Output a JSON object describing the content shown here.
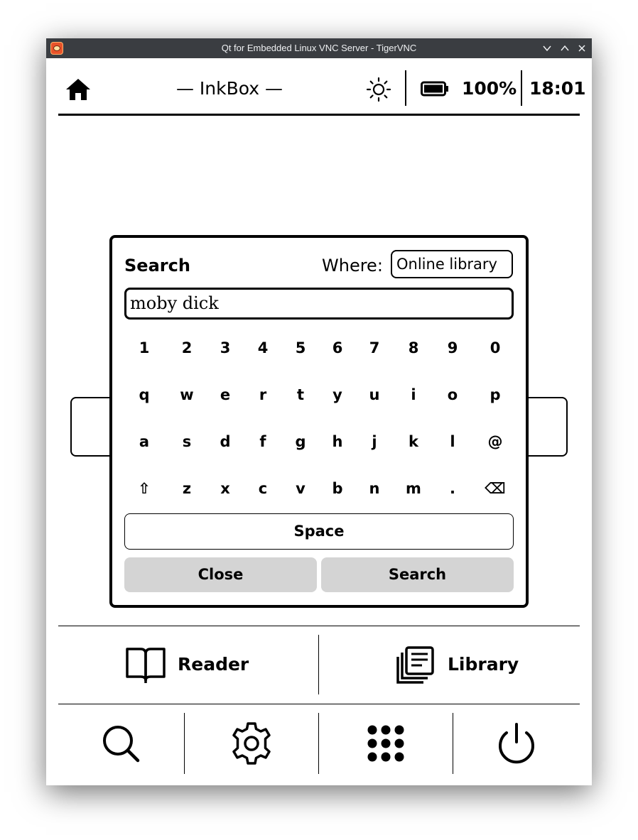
{
  "window": {
    "title": "Qt for Embedded Linux VNC Server - TigerVNC",
    "controls": [
      "minimize",
      "maximize",
      "close"
    ]
  },
  "header": {
    "brand": "— InkBox —",
    "battery_level": "100%",
    "time": "18:01",
    "icons": [
      "home-icon",
      "brightness-icon",
      "battery-full-icon"
    ]
  },
  "search_dialog": {
    "title": "Search",
    "where_label": "Where:",
    "where_value": "Online library",
    "query": "moby dick",
    "keyboard": {
      "row1": [
        "1",
        "2",
        "3",
        "4",
        "5",
        "6",
        "7",
        "8",
        "9",
        "0"
      ],
      "row2": [
        "q",
        "w",
        "e",
        "r",
        "t",
        "y",
        "u",
        "i",
        "o",
        "p"
      ],
      "row3": [
        "a",
        "s",
        "d",
        "f",
        "g",
        "h",
        "j",
        "k",
        "l",
        "@"
      ],
      "row4": [
        "⇧",
        "z",
        "x",
        "c",
        "v",
        "b",
        "n",
        "m",
        ".",
        "⌫"
      ]
    },
    "space_label": "Space",
    "close_label": "Close",
    "search_label": "Search"
  },
  "nav": {
    "reader_label": "Reader",
    "library_label": "Library"
  },
  "toolbar": {
    "icons": [
      "search-icon",
      "settings-gear-icon",
      "apps-grid-icon",
      "power-icon"
    ]
  },
  "colors": {
    "titlebar_bg": "#3a3d41",
    "button_gray": "#d4d4d4",
    "ink": "#000000",
    "paper": "#ffffff"
  }
}
